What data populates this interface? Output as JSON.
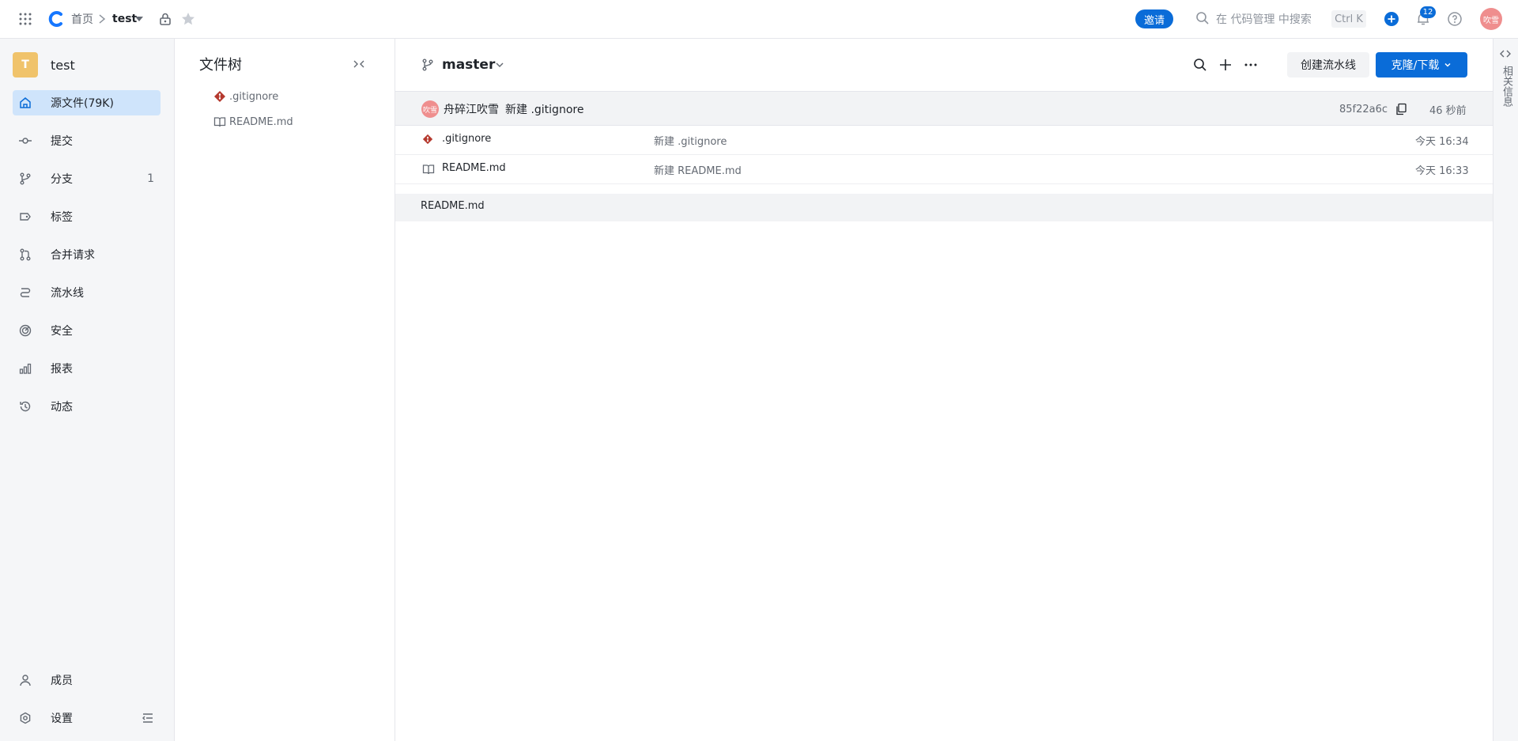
{
  "topbar": {
    "breadcrumb_home": "首页",
    "repo_name": "test",
    "invite_label": "邀请",
    "search_placeholder": "在 代码管理 中搜索",
    "search_shortcut": "Ctrl K",
    "notification_count": "12",
    "avatar_text": "吹雪"
  },
  "sidebar": {
    "repo_initial": "T",
    "repo_name": "test",
    "items": [
      {
        "label": "源文件(79K)",
        "icon": "home-icon"
      },
      {
        "label": "提交",
        "icon": "commit-icon"
      },
      {
        "label": "分支",
        "icon": "branch-icon",
        "count": "1"
      },
      {
        "label": "标签",
        "icon": "tag-icon"
      },
      {
        "label": "合并请求",
        "icon": "merge-request-icon"
      },
      {
        "label": "流水线",
        "icon": "pipeline-icon"
      },
      {
        "label": "安全",
        "icon": "security-icon"
      },
      {
        "label": "报表",
        "icon": "chart-icon"
      },
      {
        "label": "动态",
        "icon": "history-icon"
      }
    ],
    "bottom": [
      {
        "label": "成员",
        "icon": "user-icon"
      },
      {
        "label": "设置",
        "icon": "gear-icon"
      }
    ]
  },
  "filetree": {
    "title": "文件树",
    "files": [
      {
        "name": ".gitignore",
        "icon": "git-icon"
      },
      {
        "name": "README.md",
        "icon": "book-icon"
      }
    ]
  },
  "main": {
    "branch": "master",
    "create_pipeline_label": "创建流水线",
    "clone_label": "克隆/下载",
    "last_commit": {
      "avatar": "吹雪",
      "author": "舟碎江吹雪",
      "message": "新建 .gitignore",
      "hash": "85f22a6c",
      "time": "46 秒前"
    },
    "files": [
      {
        "name": ".gitignore",
        "icon": "git-icon",
        "message": "新建 .gitignore",
        "time": "今天 16:34"
      },
      {
        "name": "README.md",
        "icon": "book-icon",
        "message": "新建 README.md",
        "time": "今天 16:33"
      }
    ],
    "readme_title": "README.md"
  },
  "rightbar": {
    "label": "相关信息"
  },
  "colors": {
    "primary": "#0a6cd8",
    "avatar_bg": "#ef8e8e",
    "repo_avatar_bg": "#f0c36b",
    "git_icon": "#b5392e"
  }
}
